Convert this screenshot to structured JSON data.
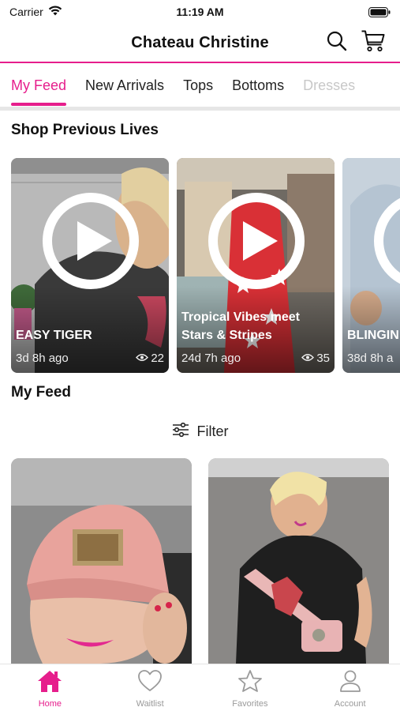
{
  "status_bar": {
    "carrier": "Carrier",
    "time": "11:19 AM"
  },
  "header": {
    "title": "Chateau Christine"
  },
  "tabs": [
    {
      "label": "My Feed",
      "active": true
    },
    {
      "label": "New Arrivals",
      "active": false
    },
    {
      "label": "Tops",
      "active": false
    },
    {
      "label": "Bottoms",
      "active": false
    },
    {
      "label": "Dresses",
      "active": false
    }
  ],
  "previous_lives": {
    "title": "Shop Previous Lives",
    "items": [
      {
        "title": "EASY TIGER",
        "time_ago": "3d 8h ago",
        "views": "22"
      },
      {
        "title": "Tropical Vibes meet Stars & Stripes",
        "time_ago": "24d 7h ago",
        "views": "35"
      },
      {
        "title": "BLINGIN THE DIVA",
        "time_ago": "38d 8h a",
        "views": ""
      }
    ]
  },
  "feed": {
    "title": "My Feed",
    "filter_label": "Filter"
  },
  "bottom_nav": [
    {
      "label": "Home",
      "icon": "home-icon",
      "active": true
    },
    {
      "label": "Waitlist",
      "icon": "heart-icon",
      "active": false
    },
    {
      "label": "Favorites",
      "icon": "star-icon",
      "active": false
    },
    {
      "label": "Account",
      "icon": "person-icon",
      "active": false
    }
  ],
  "colors": {
    "accent": "#e61e8c",
    "text": "#111111",
    "muted": "#9a9a9a"
  }
}
